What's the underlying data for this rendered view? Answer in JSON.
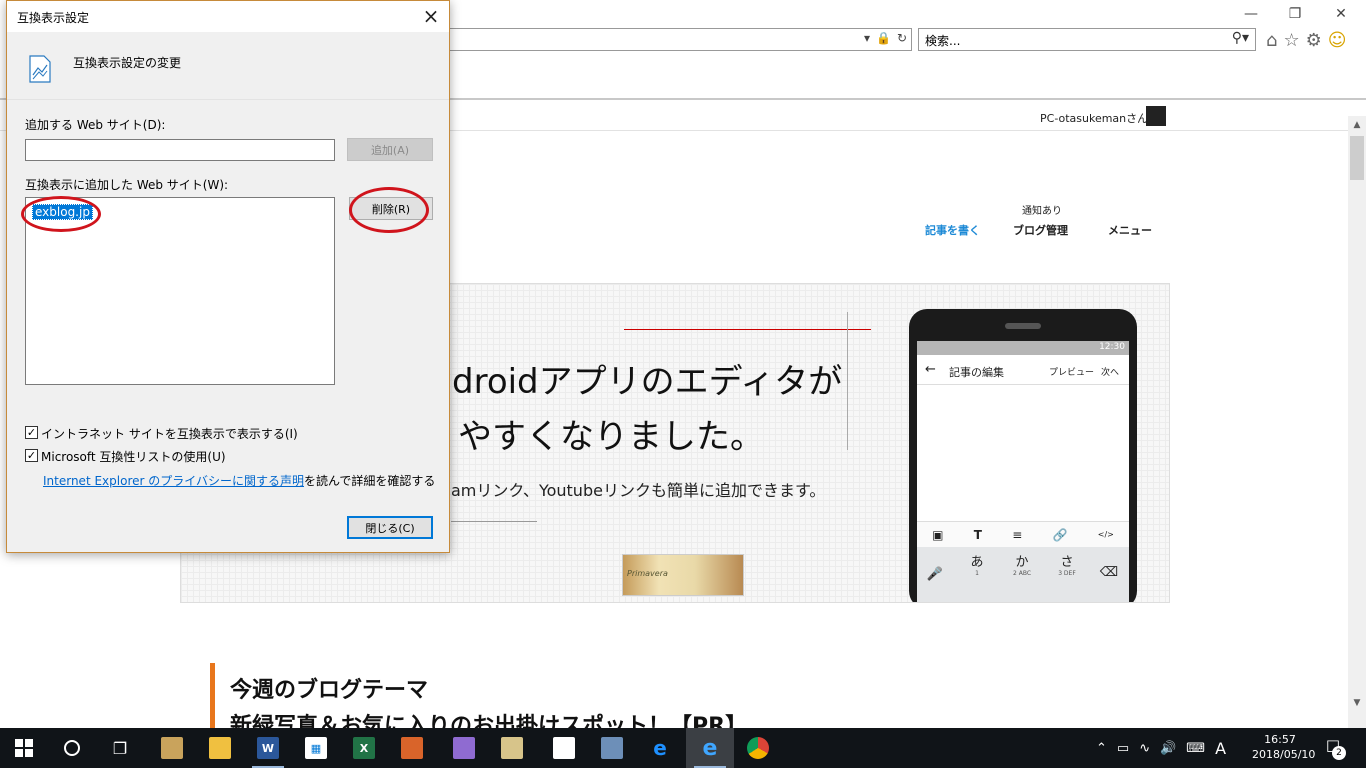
{
  "browser": {
    "search_placeholder": "検索...",
    "window_controls": [
      "minimize-icon",
      "restore-icon",
      "close-icon"
    ]
  },
  "page": {
    "user_name": "PC-otasukemanさん",
    "notice": "通知あり",
    "nav": {
      "write": "記事を書く",
      "manage": "ブログ管理",
      "menu": "メニュー"
    },
    "banner": {
      "headline1": "droidアプリのエディタが",
      "headline2": "やすくなりました。",
      "subline": "amリンク、Youtubeリンクも簡単に追加できます。",
      "thumb_text": "Primavera"
    },
    "phone": {
      "time": "12:30",
      "title": "記事の編集",
      "preview": "プレビュー",
      "next": "次へ",
      "toolbar": [
        "image-icon",
        "text-icon",
        "align-icon",
        "link-icon",
        "html-icon"
      ],
      "keys": [
        {
          "main": "あ",
          "sub": "1"
        },
        {
          "main": "か",
          "sub": "2 ABC"
        },
        {
          "main": "さ",
          "sub": "3 DEF"
        }
      ]
    },
    "theme_title": "今週のブログテーマ",
    "theme_sub": "新緑写真＆お気に入りのお出掛けスポット！【PR】"
  },
  "dialog": {
    "title": "互換表示設定",
    "header": "互換表示設定の変更",
    "add_label": "追加する Web サイト(D):",
    "add_value": "",
    "add_button": "追加(A)",
    "list_label": "互換表示に追加した Web サイト(W):",
    "sites": [
      "exblog.jp"
    ],
    "remove_button": "削除(R)",
    "options": [
      {
        "label": "イントラネット サイトを互換表示で表示する(I)",
        "checked": true
      },
      {
        "label": "Microsoft 互換性リストの使用(U)",
        "checked": true
      }
    ],
    "privacy_link": "Internet Explorer のプライバシーに関する声明",
    "privacy_suffix": "を読んで詳細を確認する",
    "close_button": "閉じる(C)"
  },
  "taskbar": {
    "clock_time": "16:57",
    "clock_date": "2018/05/10",
    "ime": "A",
    "notifications": "2"
  },
  "colors": {
    "accent_blue": "#0078d7",
    "highlight_circle": "#d0141c",
    "theme_orange": "#e8761c",
    "taskbar": "#101418"
  }
}
